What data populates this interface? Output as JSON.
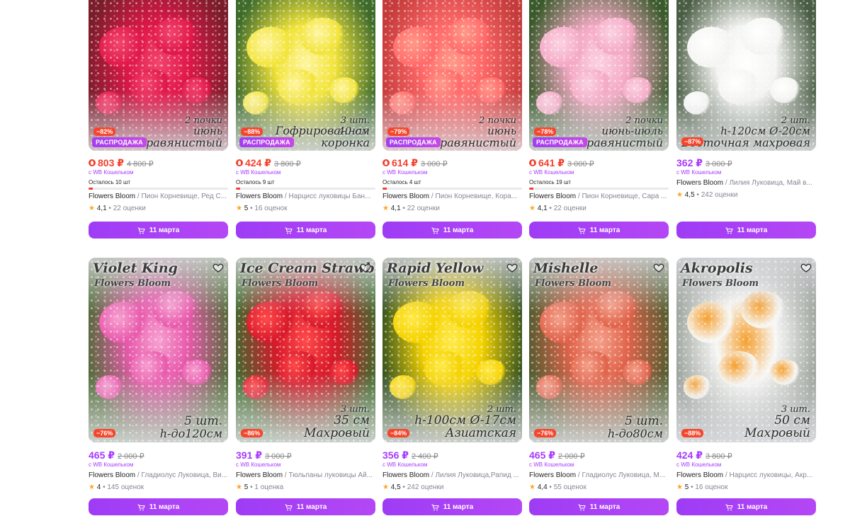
{
  "rows": [
    [
      {
        "price": "803 ₽",
        "old": "4 800 ₽",
        "discount": "−82%",
        "sale": "РАСПРОДАЖА",
        "wallet": "с WB Кошельком",
        "stock": "Осталось 10 шт",
        "stock_fill": 0.03,
        "brand": "Flowers Bloom",
        "desc": " / Пион Корневище, Ред С...",
        "rating": "4,1",
        "reviews": "22 оценки",
        "delivery": "11 марта",
        "overlay": [
          "2 почки",
          "июнь",
          "Травянистый"
        ],
        "colors": {
          "bg": "#7a1d2a",
          "petal": "#e0184a",
          "accent": "#f2456e"
        }
      },
      {
        "price": "424 ₽",
        "old": "3 800 ₽",
        "discount": "−88%",
        "sale": "РАСПРОДАЖА",
        "wallet": "с WB Кошельком",
        "stock": "Осталось 9 шт",
        "stock_fill": 0.03,
        "brand": "Flowers Bloom",
        "desc": " / Нарцисс луковицы Бан...",
        "rating": "5",
        "reviews": "16 оценок",
        "delivery": "11 марта",
        "overlay": [
          "3 шт.",
          "40 см",
          "Гофрированная коронка"
        ],
        "colors": {
          "bg": "#3e6b2a",
          "petal": "#f2e43a",
          "accent": "#fff5a0"
        }
      },
      {
        "price": "614 ₽",
        "old": "3 000 ₽",
        "discount": "−79%",
        "sale": "РАСПРОДАЖА",
        "wallet": "с WB Кошельком",
        "stock": "Осталось 4 шт",
        "stock_fill": 0.03,
        "brand": "Flowers Bloom",
        "desc": " / Пион Корневище, Кора...",
        "rating": "4,1",
        "reviews": "22 оценки",
        "delivery": "11 марта",
        "overlay": [
          "2 почки",
          "июнь",
          "Травянистый"
        ],
        "colors": {
          "bg": "#c53a3a",
          "petal": "#ff6a6a",
          "accent": "#ff9a8a"
        }
      },
      {
        "price": "641 ₽",
        "old": "3 000 ₽",
        "discount": "−78%",
        "sale": "РАСПРОДАЖА",
        "wallet": "с WB Кошельком",
        "stock": "Осталось 19 шт",
        "stock_fill": 0.03,
        "brand": "Flowers Bloom",
        "desc": " / Пион Корневище, Сара ...",
        "rating": "4,1",
        "reviews": "22 оценки",
        "delivery": "11 марта",
        "overlay": [
          "2 почки",
          "июнь-июль",
          "Травянистый"
        ],
        "colors": {
          "bg": "#3b5a2c",
          "petal": "#f4a9c4",
          "accent": "#fbd2e1"
        }
      },
      {
        "price": "362 ₽",
        "old": "3 000 ₽",
        "discount": "−87%",
        "sale": "",
        "wallet": "с WB Кошельком",
        "stock": "",
        "stock_fill": 0,
        "brand": "Flowers Bloom",
        "desc": " / Лилия Луковица, Май в...",
        "rating": "4,5",
        "reviews": "242 оценки",
        "delivery": "11 марта",
        "overlay": [
          "2 шт.",
          "h-120см Ø-20см",
          "Восточная махровая"
        ],
        "colors": {
          "bg": "#4a5d44",
          "petal": "#f4f4f2",
          "accent": "#ffffff"
        }
      }
    ],
    [
      {
        "price": "465 ₽",
        "old": "2 000 ₽",
        "discount": "−76%",
        "wallet": "с WB Кошельком",
        "brand": "Flowers Bloom",
        "desc": " / Гладиолус Луковица, Ви...",
        "rating": "4",
        "reviews": "145 оценок",
        "delivery": "11 марта",
        "title": "Violet King",
        "brandmark": "Flowers Bloom",
        "overlay": [
          "5 шт.",
          "h-до120см"
        ],
        "colors": {
          "bg": "#4f6b36",
          "petal": "#e85aac",
          "accent": "#f7a0d1"
        }
      },
      {
        "price": "391 ₽",
        "old": "3 000 ₽",
        "discount": "−86%",
        "wallet": "с WB Кошельком",
        "brand": "Flowers Bloom",
        "desc": " / Тюльпаны луковицы Ай...",
        "rating": "5",
        "reviews": "1 оценка",
        "delivery": "11 марта",
        "title": "Ice Cream Strawberry",
        "brandmark": "Flowers Bloom",
        "overlay": [
          "3 шт.",
          "35 см",
          "Махровый"
        ],
        "colors": {
          "bg": "#3f6a2c",
          "petal": "#d8192a",
          "accent": "#ff4a4a"
        }
      },
      {
        "price": "356 ₽",
        "old": "2 400 ₽",
        "discount": "−84%",
        "wallet": "с WB Кошельком",
        "brand": "Flowers Bloom",
        "desc": " / Лилия Луковица,Рапид ...",
        "rating": "4,5",
        "reviews": "242 оценки",
        "delivery": "11 марта",
        "title": "Rapid Yellow",
        "brandmark": "Flowers Bloom",
        "overlay": [
          "2 шт.",
          "h-100см Ø-17см",
          "Азиатская"
        ],
        "colors": {
          "bg": "#2f4f1f",
          "petal": "#f5d300",
          "accent": "#ffe94a"
        }
      },
      {
        "price": "465 ₽",
        "old": "2 000 ₽",
        "discount": "−76%",
        "wallet": "с WB Кошельком",
        "brand": "Flowers Bloom",
        "desc": " / Гладиолус Луковица, М...",
        "rating": "4,4",
        "reviews": "55 оценок",
        "delivery": "11 марта",
        "title": "Mishelle",
        "brandmark": "Flowers Bloom",
        "overlay": [
          "5 шт.",
          "h-до80см"
        ],
        "colors": {
          "bg": "#4d5b2d",
          "petal": "#e0634a",
          "accent": "#f5a08a"
        }
      },
      {
        "price": "424 ₽",
        "old": "3 800 ₽",
        "discount": "−88%",
        "wallet": "с WB Кошельком",
        "brand": "Flowers Bloom",
        "desc": " / Нарцисс луковицы, Акр...",
        "rating": "5",
        "reviews": "16 оценок",
        "delivery": "11 марта",
        "title": "Akropolis",
        "brandmark": "Flowers Bloom",
        "overlay": [
          "3 шт.",
          "50 см",
          "Махровый"
        ],
        "colors": {
          "bg": "#9aa19a",
          "petal": "#f7f7f5",
          "accent": "#f5a030"
        }
      }
    ]
  ],
  "icons": {
    "heart": "heart-icon",
    "cart": "cart-icon",
    "star": "star-icon",
    "fire": "fire-icon"
  }
}
